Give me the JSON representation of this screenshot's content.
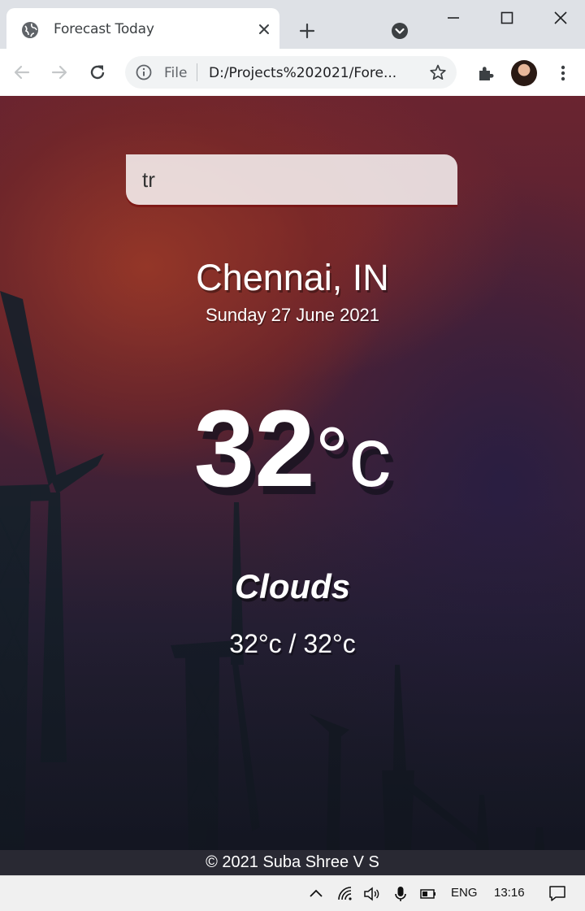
{
  "browser": {
    "tab_title": "Forecast Today",
    "url_scheme": "File",
    "url": "D:/Projects%202021/Forecast Today/index.html",
    "url_display": "D:/Projects%202021/Fore..."
  },
  "app": {
    "search_value": "tr",
    "location": "Chennai, IN",
    "date": "Sunday 27 June 2021",
    "temperature": "32",
    "temperature_unit": "°c",
    "weather": "Clouds",
    "hi_low": "32°c / 32°c",
    "footer": "© 2021 Suba Shree V S"
  },
  "taskbar": {
    "language": "ENG",
    "time": "13:16"
  },
  "icons": [
    "globe-icon",
    "close-icon",
    "plus-icon",
    "tab-search-icon",
    "minimize-icon",
    "maximize-icon",
    "window-close-icon",
    "back-icon",
    "forward-icon",
    "reload-icon",
    "info-icon",
    "star-icon",
    "extensions-icon",
    "menu-icon",
    "chevron-up-icon",
    "wifi-icon",
    "volume-icon",
    "microphone-icon",
    "battery-icon",
    "notifications-icon"
  ],
  "colors": {
    "tab_strip": "#dee1e6",
    "search_shadow": "#780a0a",
    "footer_bg": "#2a2a34"
  }
}
